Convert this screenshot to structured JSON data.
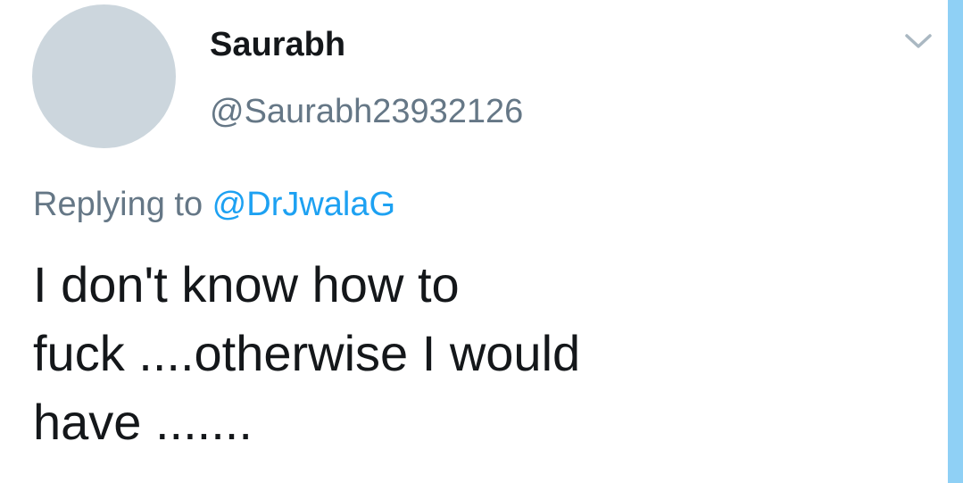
{
  "tweet": {
    "display_name": "Saurabh",
    "handle": "@Saurabh23932126",
    "replying_prefix": "Replying to ",
    "replying_to": "@DrJwalaG",
    "text": "I don't know how to\nfuck ....otherwise I would\nhave .......",
    "menu_icon": "chevron-down-icon"
  },
  "colors": {
    "avatar_placeholder": "#ccd6dd",
    "name": "#14171a",
    "secondary": "#657786",
    "link": "#1da1f2",
    "side_accent": "#8fd0f5"
  }
}
